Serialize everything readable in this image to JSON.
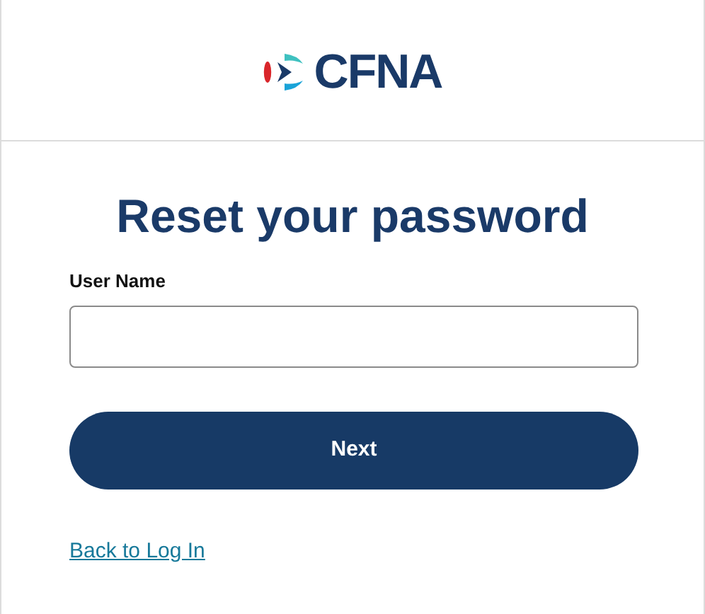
{
  "header": {
    "logo_text": "CFNA"
  },
  "title": "Reset your password",
  "fields": [
    {
      "label": "User Name"
    }
  ],
  "buttons": [
    {
      "label": "Next"
    }
  ],
  "link": "Back to Log In"
}
